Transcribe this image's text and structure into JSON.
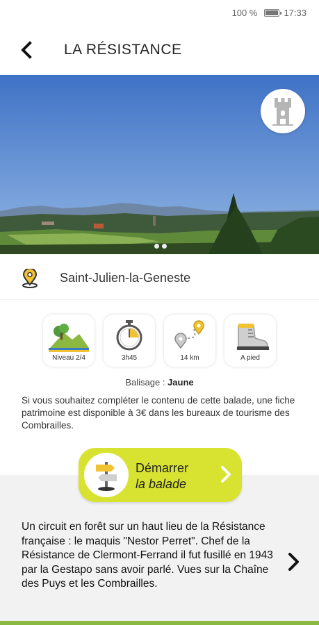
{
  "status_bar": {
    "battery": "100 %",
    "battery_level": 1.0,
    "time": "17:33"
  },
  "header": {
    "title": "LA RÉSISTANCE",
    "back_icon": "chevron-left-icon"
  },
  "hero": {
    "badge_icon": "tower-icon",
    "carousel_dots": 2
  },
  "location": {
    "icon": "map-pin-icon",
    "name": "Saint-Julien-la-Geneste"
  },
  "stats": [
    {
      "icon": "hills-icon",
      "label": "Niveau 2/4"
    },
    {
      "icon": "stopwatch-icon",
      "label": "3h45"
    },
    {
      "icon": "route-icon",
      "label": "14 km"
    },
    {
      "icon": "hiking-boot-icon",
      "label": "A pied"
    }
  ],
  "balisage": {
    "label": "Balisage :",
    "value": "Jaune"
  },
  "info_text": "Si vous souhaitez compléter le contenu de cette balade, une fiche patrimoine est disponible à 3€ dans les bureaux de tourisme des Combrailles.",
  "start_button": {
    "line1": "Démarrer",
    "line2": "la balade",
    "icon": "signpost-icon"
  },
  "description": "Un circuit en forêt sur un haut lieu de la Résistance française : le maquis \"Nestor Perret\". Chef de la Résistance de Clermont-Ferrand il fut fusillé en 1943 par la Gestapo sans avoir parlé. Vues sur la Chaîne des Puys et les Combrailles.",
  "colors": {
    "accent": "#d8e331",
    "brand_green": "#8ab840",
    "pin_yellow": "#f1c232"
  }
}
